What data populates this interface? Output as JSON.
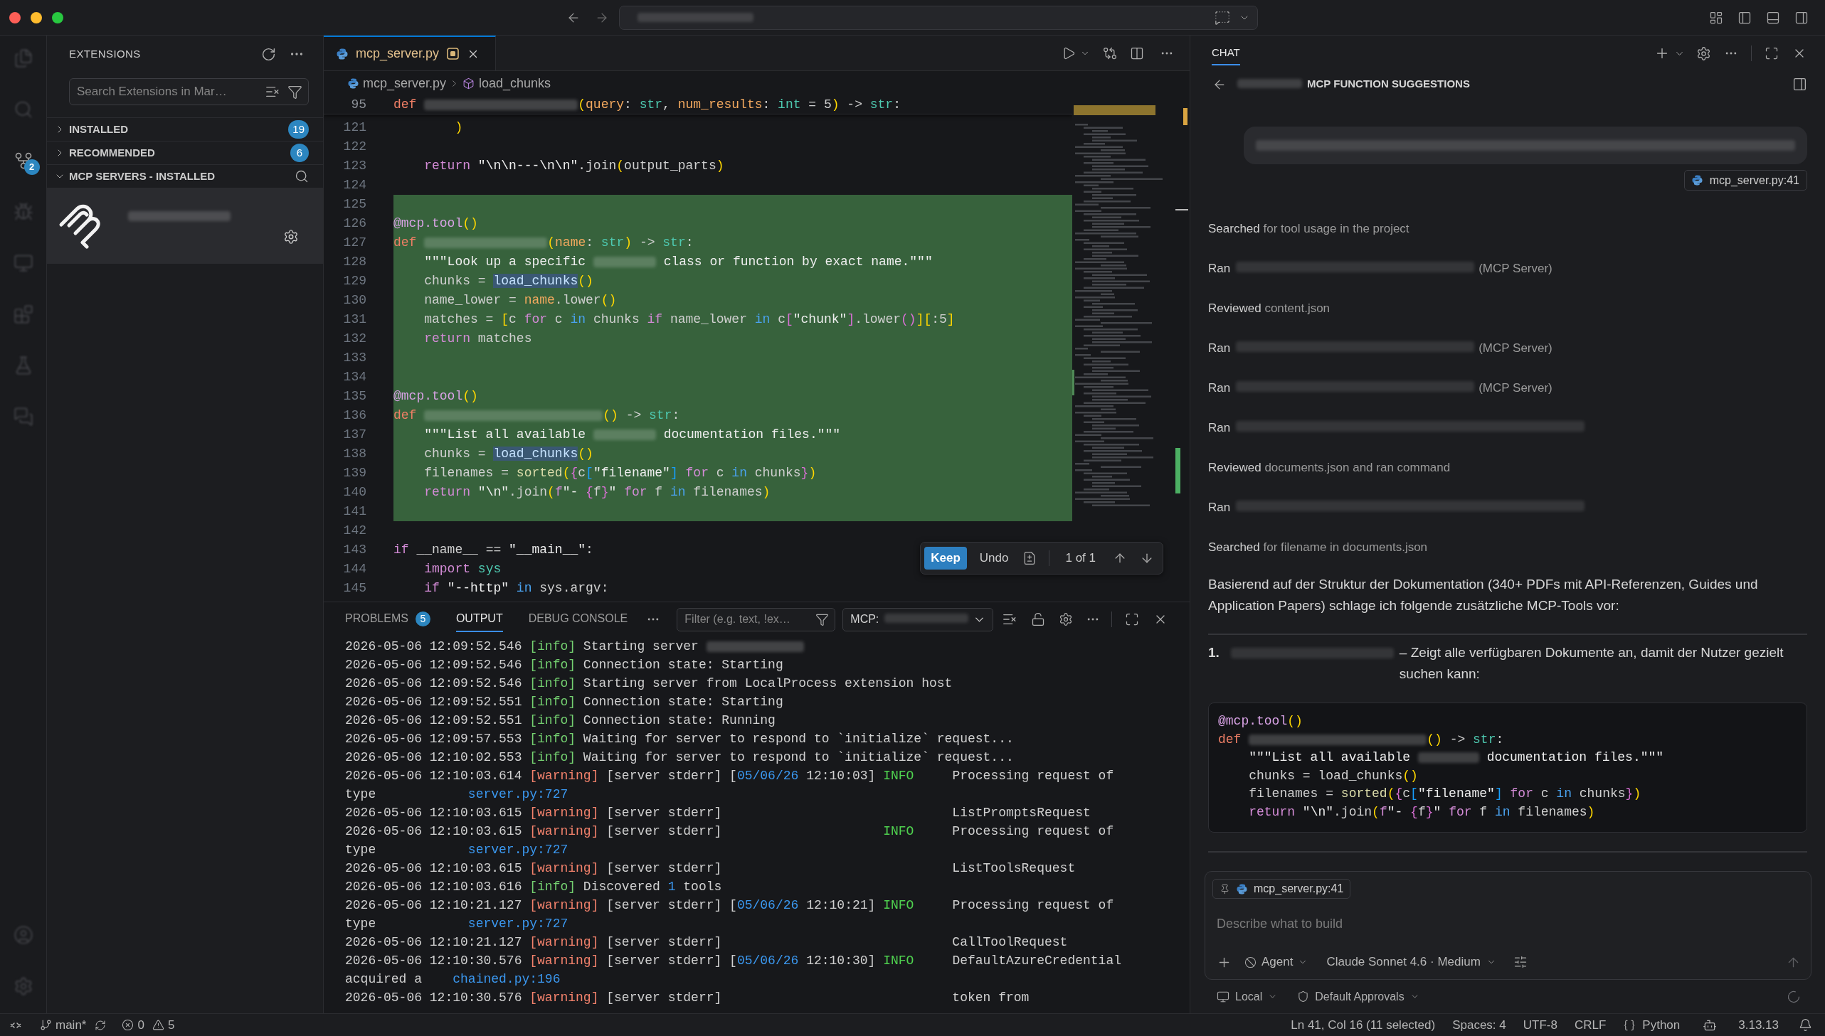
{
  "activity_bar": {
    "source_control_badge": "2"
  },
  "sidebar": {
    "title": "EXTENSIONS",
    "search": {
      "placeholder": "Search Extensions in Mar…"
    },
    "sections": [
      {
        "label": "INSTALLED",
        "expanded": false,
        "count": "19"
      },
      {
        "label": "RECOMMENDED",
        "expanded": false,
        "count": "6"
      },
      {
        "label": "MCP SERVERS - INSTALLED",
        "expanded": true
      }
    ],
    "mcp_servers": [
      {
        "selected": true
      }
    ]
  },
  "editor": {
    "tabs": [
      {
        "label": "mcp_server.py",
        "selected": true,
        "modified": true
      }
    ],
    "breadcrumb": [
      {
        "kind": "file",
        "label": "mcp_server.py"
      },
      {
        "kind": "symbol",
        "label": "load_chunks"
      }
    ],
    "sticky_line": {
      "number": "95",
      "tokens": [
        {
          "kind": "keyword",
          "text": "def "
        },
        {
          "kind": "blur"
        },
        {
          "kind": "bracket",
          "text": "("
        },
        {
          "kind": "param",
          "text": "query"
        },
        {
          "kind": "plain",
          "text": ": "
        },
        {
          "kind": "type",
          "text": "str"
        },
        {
          "kind": "plain",
          "text": ", "
        },
        {
          "kind": "param",
          "text": "num_results"
        },
        {
          "kind": "plain",
          "text": ": "
        },
        {
          "kind": "type",
          "text": "int"
        },
        {
          "kind": "plain",
          "text": " = 5"
        },
        {
          "kind": "bracket",
          "text": ")"
        },
        {
          "kind": "plain",
          "text": " -> "
        },
        {
          "kind": "type",
          "text": "str"
        },
        {
          "kind": "plain",
          "text": ":"
        }
      ]
    },
    "lines": [
      {
        "number": "121",
        "added": false,
        "tokens": [
          {
            "kind": "bracket",
            "text": "        )"
          }
        ]
      },
      {
        "number": "122",
        "added": false
      },
      {
        "number": "123",
        "added": false,
        "tokens": [
          {
            "kind": "control",
            "text": "    return "
          },
          {
            "kind": "string",
            "text": "\"\\n\\n---\\n\\n\""
          },
          {
            "kind": "plain",
            "text": ".join"
          },
          {
            "kind": "bracket",
            "text": "("
          },
          {
            "kind": "plain",
            "text": "output_parts"
          },
          {
            "kind": "bracket",
            "text": ")"
          }
        ]
      },
      {
        "number": "124",
        "added": false
      },
      {
        "number": "125",
        "added": true
      },
      {
        "number": "126",
        "added": true,
        "tokens": [
          {
            "kind": "decorator",
            "text": "@mcp.tool"
          },
          {
            "kind": "bracket",
            "text": "()"
          }
        ]
      },
      {
        "number": "127",
        "added": true,
        "tokens": [
          {
            "kind": "keyword",
            "text": "def "
          },
          {
            "kind": "blur"
          },
          {
            "kind": "bracket",
            "text": "("
          },
          {
            "kind": "param",
            "text": "name"
          },
          {
            "kind": "plain",
            "text": ": "
          },
          {
            "kind": "type",
            "text": "str"
          },
          {
            "kind": "bracket",
            "text": ")"
          },
          {
            "kind": "plain",
            "text": " -> "
          },
          {
            "kind": "type",
            "text": "str"
          },
          {
            "kind": "plain",
            "text": ":"
          }
        ]
      },
      {
        "number": "128",
        "added": true,
        "tokens": [
          {
            "kind": "string",
            "text": "    \"\"\"Look up a specific "
          },
          {
            "kind": "blur"
          },
          {
            "kind": "string",
            "text": " class or function by exact name.\"\"\""
          }
        ]
      },
      {
        "number": "129",
        "added": true,
        "tokens": [
          {
            "kind": "plain",
            "text": "    chunks = "
          },
          {
            "kind": "match",
            "text": "load_chunks"
          },
          {
            "kind": "bracket",
            "text": "()"
          }
        ]
      },
      {
        "number": "130",
        "added": true,
        "tokens": [
          {
            "kind": "plain",
            "text": "    name_lower = "
          },
          {
            "kind": "param",
            "text": "name"
          },
          {
            "kind": "plain",
            "text": ".lower"
          },
          {
            "kind": "bracket",
            "text": "()"
          }
        ]
      },
      {
        "number": "131",
        "added": true,
        "tokens": [
          {
            "kind": "plain",
            "text": "    matches = "
          },
          {
            "kind": "bracket",
            "text": "["
          },
          {
            "kind": "plain",
            "text": "c "
          },
          {
            "kind": "control",
            "text": "for"
          },
          {
            "kind": "plain",
            "text": " c "
          },
          {
            "kind": "logic",
            "text": "in"
          },
          {
            "kind": "plain",
            "text": " chunks "
          },
          {
            "kind": "control",
            "text": "if"
          },
          {
            "kind": "plain",
            "text": " name_lower "
          },
          {
            "kind": "logic",
            "text": "in"
          },
          {
            "kind": "plain",
            "text": " c"
          },
          {
            "kind": "bracket2",
            "text": "["
          },
          {
            "kind": "string",
            "text": "\"chunk\""
          },
          {
            "kind": "bracket2",
            "text": "]"
          },
          {
            "kind": "plain",
            "text": ".lower"
          },
          {
            "kind": "bracket2",
            "text": "()"
          },
          {
            "kind": "bracket",
            "text": "]["
          },
          {
            "kind": "plain",
            "text": ":5"
          },
          {
            "kind": "bracket",
            "text": "]"
          }
        ]
      },
      {
        "number": "132",
        "added": true,
        "tokens": [
          {
            "kind": "control",
            "text": "    return"
          },
          {
            "kind": "plain",
            "text": " matches"
          }
        ]
      },
      {
        "number": "133",
        "added": true
      },
      {
        "number": "134",
        "added": true
      },
      {
        "number": "135",
        "added": true,
        "tokens": [
          {
            "kind": "decorator",
            "text": "@mcp.tool"
          },
          {
            "kind": "bracket",
            "text": "()"
          }
        ]
      },
      {
        "number": "136",
        "added": true,
        "tokens": [
          {
            "kind": "keyword",
            "text": "def "
          },
          {
            "kind": "blur"
          },
          {
            "kind": "bracket",
            "text": "()"
          },
          {
            "kind": "plain",
            "text": " -> "
          },
          {
            "kind": "type",
            "text": "str"
          },
          {
            "kind": "plain",
            "text": ":"
          }
        ]
      },
      {
        "number": "137",
        "added": true,
        "tokens": [
          {
            "kind": "string",
            "text": "    \"\"\"List all available "
          },
          {
            "kind": "blur"
          },
          {
            "kind": "string",
            "text": " documentation files.\"\"\""
          }
        ]
      },
      {
        "number": "138",
        "added": true,
        "tokens": [
          {
            "kind": "plain",
            "text": "    chunks = "
          },
          {
            "kind": "match",
            "text": "load_chunks"
          },
          {
            "kind": "bracket",
            "text": "()"
          }
        ]
      },
      {
        "number": "139",
        "added": true,
        "tokens": [
          {
            "kind": "plain",
            "text": "    filenames = "
          },
          {
            "kind": "call",
            "text": "sorted"
          },
          {
            "kind": "bracket",
            "text": "("
          },
          {
            "kind": "bracket2",
            "text": "{"
          },
          {
            "kind": "plain",
            "text": "c"
          },
          {
            "kind": "bracket3",
            "text": "["
          },
          {
            "kind": "string",
            "text": "\"filename\""
          },
          {
            "kind": "bracket3",
            "text": "] "
          },
          {
            "kind": "control",
            "text": "for"
          },
          {
            "kind": "plain",
            "text": " c "
          },
          {
            "kind": "logic",
            "text": "in"
          },
          {
            "kind": "plain",
            "text": " chunks"
          },
          {
            "kind": "bracket2",
            "text": "}"
          },
          {
            "kind": "bracket",
            "text": ")"
          }
        ]
      },
      {
        "number": "140",
        "added": true,
        "tokens": [
          {
            "kind": "control",
            "text": "    return "
          },
          {
            "kind": "string",
            "text": "\"\\n\""
          },
          {
            "kind": "plain",
            "text": ".join"
          },
          {
            "kind": "bracket",
            "text": "("
          },
          {
            "kind": "control",
            "text": "f"
          },
          {
            "kind": "string",
            "text": "\"- "
          },
          {
            "kind": "bracket2",
            "text": "{"
          },
          {
            "kind": "plain",
            "text": "f"
          },
          {
            "kind": "bracket2",
            "text": "}"
          },
          {
            "kind": "string",
            "text": "\" "
          },
          {
            "kind": "control",
            "text": "for"
          },
          {
            "kind": "plain",
            "text": " f "
          },
          {
            "kind": "logic",
            "text": "in"
          },
          {
            "kind": "plain",
            "text": " filenames"
          },
          {
            "kind": "bracket",
            "text": ")"
          }
        ]
      },
      {
        "number": "141",
        "added": true
      },
      {
        "number": "142",
        "added": false
      },
      {
        "number": "143",
        "added": false,
        "tokens": [
          {
            "kind": "control",
            "text": "if"
          },
          {
            "kind": "plain",
            "text": " __name__ == "
          },
          {
            "kind": "string",
            "text": "\"__main__\""
          },
          {
            "kind": "plain",
            "text": ":"
          }
        ]
      },
      {
        "number": "144",
        "added": false,
        "tokens": [
          {
            "kind": "control",
            "text": "    import "
          },
          {
            "kind": "type",
            "text": "sys"
          }
        ]
      },
      {
        "number": "145",
        "added": false,
        "tokens": [
          {
            "kind": "control",
            "text": "    if "
          },
          {
            "kind": "string",
            "text": "\"--http\" "
          },
          {
            "kind": "logic",
            "text": "in"
          },
          {
            "kind": "plain",
            "text": " sys.argv:"
          }
        ]
      }
    ],
    "diff_toolbar": {
      "keep": "Keep",
      "undo": "Undo",
      "counter": "1 of 1"
    }
  },
  "panel": {
    "tabs": [
      {
        "label": "PROBLEMS",
        "badge": "5",
        "selected": false
      },
      {
        "label": "OUTPUT",
        "selected": true
      },
      {
        "label": "DEBUG CONSOLE",
        "selected": false
      }
    ],
    "filter": {
      "placeholder": "Filter (e.g. text, !ex…"
    },
    "channel": {
      "label": "MCP:"
    },
    "lines": [
      {
        "tokens": [
          {
            "kind": "plain",
            "text": "2026-05-06 12:09:52.546 "
          },
          {
            "kind": "info",
            "text": "[info]"
          },
          {
            "kind": "plain",
            "text": " Starting server "
          },
          {
            "kind": "blur"
          }
        ]
      },
      {
        "tokens": [
          {
            "kind": "plain",
            "text": "2026-05-06 12:09:52.546 "
          },
          {
            "kind": "info",
            "text": "[info]"
          },
          {
            "kind": "plain",
            "text": " Connection state: Starting"
          }
        ]
      },
      {
        "tokens": [
          {
            "kind": "plain",
            "text": "2026-05-06 12:09:52.546 "
          },
          {
            "kind": "info",
            "text": "[info]"
          },
          {
            "kind": "plain",
            "text": " Starting server from LocalProcess extension host"
          }
        ]
      },
      {
        "tokens": [
          {
            "kind": "plain",
            "text": "2026-05-06 12:09:52.551 "
          },
          {
            "kind": "info",
            "text": "[info]"
          },
          {
            "kind": "plain",
            "text": " Connection state: Starting"
          }
        ]
      },
      {
        "tokens": [
          {
            "kind": "plain",
            "text": "2026-05-06 12:09:52.551 "
          },
          {
            "kind": "info",
            "text": "[info]"
          },
          {
            "kind": "plain",
            "text": " Connection state: Running"
          }
        ]
      },
      {
        "tokens": [
          {
            "kind": "plain",
            "text": "2026-05-06 12:09:57.553 "
          },
          {
            "kind": "info",
            "text": "[info]"
          },
          {
            "kind": "plain",
            "text": " Waiting for server to respond to `initialize` request..."
          }
        ]
      },
      {
        "tokens": [
          {
            "kind": "plain",
            "text": "2026-05-06 12:10:02.553 "
          },
          {
            "kind": "info",
            "text": "[info]"
          },
          {
            "kind": "plain",
            "text": " Waiting for server to respond to `initialize` request..."
          }
        ]
      },
      {
        "tokens": [
          {
            "kind": "plain",
            "text": "2026-05-06 12:10:03.614 "
          },
          {
            "kind": "warning",
            "text": "[warning]"
          },
          {
            "kind": "plain",
            "text": " [server stderr] ["
          },
          {
            "kind": "number",
            "text": "05/06/26"
          },
          {
            "kind": "plain",
            "text": " 12:10:03] "
          },
          {
            "kind": "level",
            "text": "INFO"
          },
          {
            "kind": "plain",
            "text": "     Processing request of"
          }
        ]
      },
      {
        "tokens": [
          {
            "kind": "plain",
            "text": "type            "
          },
          {
            "kind": "link",
            "text": "server.py:727"
          }
        ]
      },
      {
        "tokens": [
          {
            "kind": "plain",
            "text": "2026-05-06 12:10:03.615 "
          },
          {
            "kind": "warning",
            "text": "[warning]"
          },
          {
            "kind": "plain",
            "text": " [server stderr]                              ListPromptsRequest"
          }
        ]
      },
      {
        "tokens": [
          {
            "kind": "plain",
            "text": "2026-05-06 12:10:03.615 "
          },
          {
            "kind": "warning",
            "text": "[warning]"
          },
          {
            "kind": "plain",
            "text": " [server stderr]                     "
          },
          {
            "kind": "level",
            "text": "INFO"
          },
          {
            "kind": "plain",
            "text": "     Processing request of"
          }
        ]
      },
      {
        "tokens": [
          {
            "kind": "plain",
            "text": "type            "
          },
          {
            "kind": "link",
            "text": "server.py:727"
          }
        ]
      },
      {
        "tokens": [
          {
            "kind": "plain",
            "text": "2026-05-06 12:10:03.615 "
          },
          {
            "kind": "warning",
            "text": "[warning]"
          },
          {
            "kind": "plain",
            "text": " [server stderr]                              ListToolsRequest"
          }
        ]
      },
      {
        "tokens": [
          {
            "kind": "plain",
            "text": "2026-05-06 12:10:03.616 "
          },
          {
            "kind": "info",
            "text": "[info]"
          },
          {
            "kind": "plain",
            "text": " Discovered "
          },
          {
            "kind": "number",
            "text": "1"
          },
          {
            "kind": "plain",
            "text": " tools"
          }
        ]
      },
      {
        "tokens": [
          {
            "kind": "plain",
            "text": "2026-05-06 12:10:21.127 "
          },
          {
            "kind": "warning",
            "text": "[warning]"
          },
          {
            "kind": "plain",
            "text": " [server stderr] ["
          },
          {
            "kind": "number",
            "text": "05/06/26"
          },
          {
            "kind": "plain",
            "text": " 12:10:21] "
          },
          {
            "kind": "level",
            "text": "INFO"
          },
          {
            "kind": "plain",
            "text": "     Processing request of"
          }
        ]
      },
      {
        "tokens": [
          {
            "kind": "plain",
            "text": "type            "
          },
          {
            "kind": "link",
            "text": "server.py:727"
          }
        ]
      },
      {
        "tokens": [
          {
            "kind": "plain",
            "text": "2026-05-06 12:10:21.127 "
          },
          {
            "kind": "warning",
            "text": "[warning]"
          },
          {
            "kind": "plain",
            "text": " [server stderr]                              CallToolRequest"
          }
        ]
      },
      {
        "tokens": [
          {
            "kind": "plain",
            "text": "2026-05-06 12:10:30.576 "
          },
          {
            "kind": "warning",
            "text": "[warning]"
          },
          {
            "kind": "plain",
            "text": " [server stderr] ["
          },
          {
            "kind": "number",
            "text": "05/06/26"
          },
          {
            "kind": "plain",
            "text": " 12:10:30] "
          },
          {
            "kind": "level",
            "text": "INFO"
          },
          {
            "kind": "plain",
            "text": "     DefaultAzureCredential"
          }
        ]
      },
      {
        "tokens": [
          {
            "kind": "plain",
            "text": "acquired a    "
          },
          {
            "kind": "link",
            "text": "chained.py:196"
          }
        ]
      },
      {
        "tokens": [
          {
            "kind": "plain",
            "text": "2026-05-06 12:10:30.576 "
          },
          {
            "kind": "warning",
            "text": "[warning]"
          },
          {
            "kind": "plain",
            "text": " [server stderr]                              token from"
          }
        ]
      }
    ]
  },
  "chat": {
    "tabs": [
      {
        "label": "CHAT",
        "selected": true
      }
    ],
    "title": "MCP FUNCTION SUGGESTIONS",
    "user_message": {
      "attachment": "mcp_server.py:41"
    },
    "steps": [
      {
        "kind": "text",
        "verb": "Searched",
        "detail": "for tool usage in the project"
      },
      {
        "kind": "tool",
        "verb": "Ran",
        "detail": "(MCP Server)"
      },
      {
        "kind": "text",
        "verb": "Reviewed",
        "detail": "content.json"
      },
      {
        "kind": "tool",
        "verb": "Ran",
        "detail": "(MCP Server)"
      },
      {
        "kind": "tool",
        "verb": "Ran",
        "detail": "(MCP Server)"
      },
      {
        "kind": "command",
        "verb": "Ran"
      },
      {
        "kind": "text",
        "verb": "Reviewed",
        "detail": "documents.json and ran command"
      },
      {
        "kind": "command",
        "verb": "Ran"
      },
      {
        "kind": "text",
        "verb": "Searched",
        "detail": "for filename in documents.json"
      }
    ],
    "paragraph": "Basierend auf der Struktur der Dokumentation (340+ PDFs mit API-Referenzen, Guides und Application Papers) schlage ich folgende zusätzliche MCP-Tools vor:",
    "suggestions": [
      {
        "number": "1.",
        "text": "– Zeigt alle verfügbaren Dokumente an, damit der Nutzer gezielt suchen kann:",
        "code": [
          {
            "tokens": [
              {
                "kind": "decorator",
                "text": "@mcp.tool"
              },
              {
                "kind": "bracket",
                "text": "()"
              }
            ]
          },
          {
            "tokens": [
              {
                "kind": "keyword",
                "text": "def "
              },
              {
                "kind": "blur"
              },
              {
                "kind": "bracket",
                "text": "()"
              },
              {
                "kind": "plain",
                "text": " -> "
              },
              {
                "kind": "type",
                "text": "str"
              },
              {
                "kind": "plain",
                "text": ":"
              }
            ]
          },
          {
            "tokens": [
              {
                "kind": "string",
                "text": "    \"\"\"List all available "
              },
              {
                "kind": "blur"
              },
              {
                "kind": "string",
                "text": " documentation files.\"\"\""
              }
            ]
          },
          {
            "tokens": [
              {
                "kind": "plain",
                "text": "    chunks = load_chunks"
              },
              {
                "kind": "bracket",
                "text": "()"
              }
            ]
          },
          {
            "tokens": [
              {
                "kind": "plain",
                "text": "    filenames = "
              },
              {
                "kind": "call",
                "text": "sorted"
              },
              {
                "kind": "bracket",
                "text": "("
              },
              {
                "kind": "bracket2",
                "text": "{"
              },
              {
                "kind": "plain",
                "text": "c"
              },
              {
                "kind": "bracket3",
                "text": "["
              },
              {
                "kind": "string",
                "text": "\"filename\""
              },
              {
                "kind": "bracket3",
                "text": "] "
              },
              {
                "kind": "control",
                "text": "for"
              },
              {
                "kind": "plain",
                "text": " c "
              },
              {
                "kind": "logic",
                "text": "in"
              },
              {
                "kind": "plain",
                "text": " chunks"
              },
              {
                "kind": "bracket2",
                "text": "}"
              },
              {
                "kind": "bracket",
                "text": ")"
              }
            ]
          },
          {
            "tokens": [
              {
                "kind": "control",
                "text": "    return "
              },
              {
                "kind": "string",
                "text": "\"\\n\""
              },
              {
                "kind": "plain",
                "text": ".join"
              },
              {
                "kind": "bracket",
                "text": "("
              },
              {
                "kind": "control",
                "text": "f"
              },
              {
                "kind": "string",
                "text": "\"- "
              },
              {
                "kind": "bracket2",
                "text": "{"
              },
              {
                "kind": "plain",
                "text": "f"
              },
              {
                "kind": "bracket2",
                "text": "}"
              },
              {
                "kind": "string",
                "text": "\" "
              },
              {
                "kind": "control",
                "text": "for"
              },
              {
                "kind": "plain",
                "text": " f "
              },
              {
                "kind": "logic",
                "text": "in"
              },
              {
                "kind": "plain",
                "text": " filenames"
              },
              {
                "kind": "bracket",
                "text": ")"
              }
            ]
          }
        ]
      }
    ],
    "input": {
      "attachment": "mcp_server.py:41",
      "placeholder": "Describe what to build",
      "mode": "Agent",
      "model": "Claude Sonnet 4.6 · Medium"
    },
    "footer": {
      "location": "Local",
      "approvals": "Default Approvals"
    }
  },
  "status_bar": {
    "branch": "main*",
    "errors": "0",
    "warnings": "5",
    "items": [
      {
        "kind": "plain",
        "text": "Ln 41, Col 16 (11 selected)"
      },
      {
        "kind": "plain",
        "text": "Spaces: 4"
      },
      {
        "kind": "plain",
        "text": "UTF-8"
      },
      {
        "kind": "plain",
        "text": "CRLF"
      },
      {
        "kind": "language",
        "text": "Python"
      },
      {
        "kind": "version",
        "text": "3.13.13"
      }
    ]
  }
}
